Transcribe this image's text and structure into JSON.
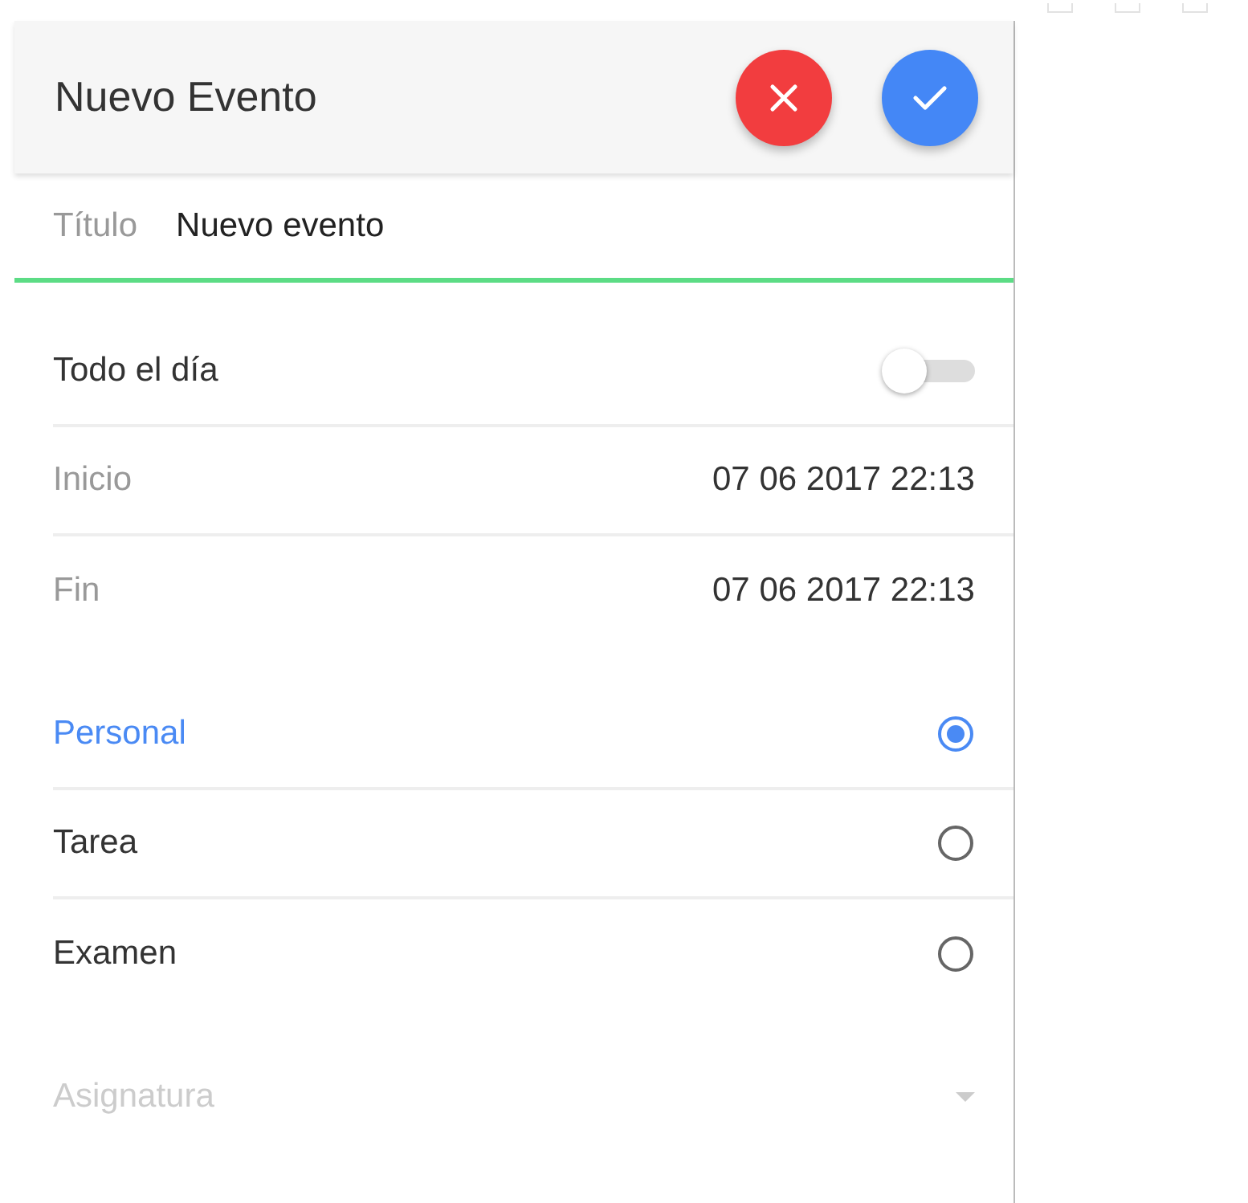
{
  "header": {
    "title": "Nuevo Evento"
  },
  "title_field": {
    "label": "Título",
    "value": "Nuevo evento"
  },
  "all_day": {
    "label": "Todo el día",
    "on": false
  },
  "times": [
    {
      "label": "Inicio",
      "value": "07 06 2017 22:13"
    },
    {
      "label": "Fin",
      "value": "07 06 2017 22:13"
    }
  ],
  "types": [
    {
      "label": "Personal",
      "selected": true
    },
    {
      "label": "Tarea",
      "selected": false
    },
    {
      "label": "Examen",
      "selected": false
    }
  ],
  "subject": {
    "placeholder": "Asignatura"
  }
}
